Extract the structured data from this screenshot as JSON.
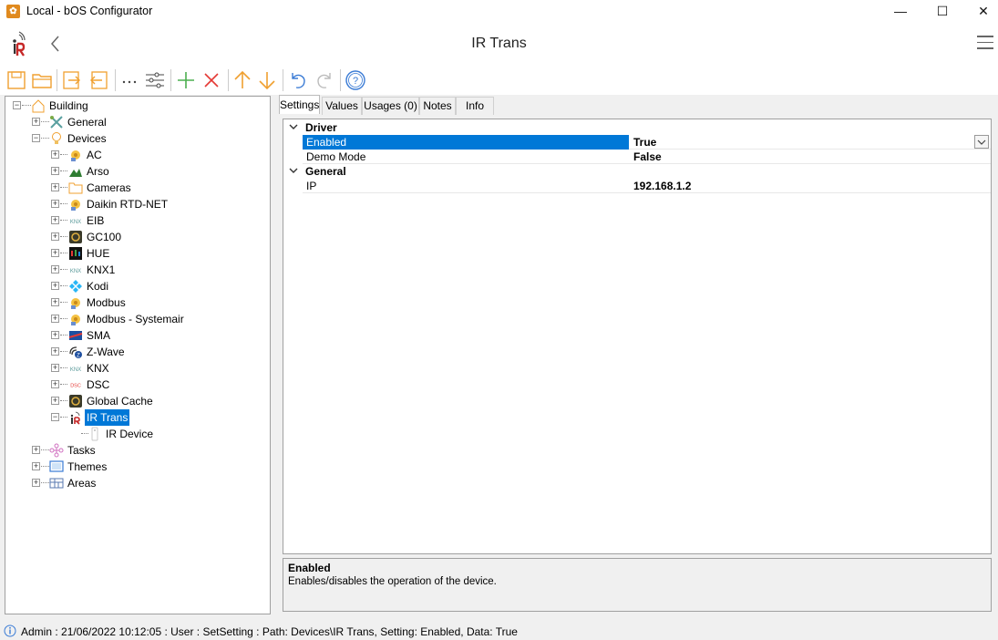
{
  "window": {
    "title": "Local - bOS Configurator",
    "minimize": "—",
    "maximize": "☐",
    "close": "✕"
  },
  "header": {
    "title": "IR Trans"
  },
  "tree": {
    "root": "Building",
    "items": [
      {
        "label": "General",
        "icon": "general-icon"
      },
      {
        "label": "Devices",
        "icon": "bulb-icon"
      },
      {
        "label": "AC",
        "icon": "driver-icon"
      },
      {
        "label": "Arso",
        "icon": "arso-icon"
      },
      {
        "label": "Cameras",
        "icon": "folder-icon"
      },
      {
        "label": "Daikin RTD-NET",
        "icon": "driver-icon"
      },
      {
        "label": "EIB",
        "icon": "knx-icon"
      },
      {
        "label": "GC100",
        "icon": "globalcache-icon"
      },
      {
        "label": "HUE",
        "icon": "hue-icon"
      },
      {
        "label": "KNX1",
        "icon": "knx-icon"
      },
      {
        "label": "Kodi",
        "icon": "kodi-icon"
      },
      {
        "label": "Modbus",
        "icon": "driver-icon"
      },
      {
        "label": "Modbus - Systemair",
        "icon": "driver-icon"
      },
      {
        "label": "SMA",
        "icon": "sma-icon"
      },
      {
        "label": "Z-Wave",
        "icon": "zwave-icon"
      },
      {
        "label": "KNX",
        "icon": "knx-icon"
      },
      {
        "label": "DSC",
        "icon": "dsc-icon"
      },
      {
        "label": "Global Cache",
        "icon": "globalcache-icon"
      },
      {
        "label": "IR Trans",
        "icon": "irtrans-icon"
      },
      {
        "label": "IR Device",
        "icon": "remote-icon"
      },
      {
        "label": "Tasks",
        "icon": "tasks-icon"
      },
      {
        "label": "Themes",
        "icon": "themes-icon"
      },
      {
        "label": "Areas",
        "icon": "areas-icon"
      }
    ]
  },
  "tabs": [
    {
      "label": "Settings"
    },
    {
      "label": "Values"
    },
    {
      "label": "Usages (0)"
    },
    {
      "label": "Notes"
    },
    {
      "label": "Info"
    }
  ],
  "grid": {
    "categories": [
      {
        "name": "Driver",
        "props": [
          {
            "name": "Enabled",
            "value": "True"
          },
          {
            "name": "Demo Mode",
            "value": "False"
          }
        ]
      },
      {
        "name": "General",
        "props": [
          {
            "name": "IP",
            "value": "192.168.1.2"
          }
        ]
      }
    ]
  },
  "description": {
    "title": "Enabled",
    "text": "Enables/disables the operation of the device."
  },
  "status": {
    "text": "Admin : 21/06/2022 10:12:05 : User : SetSetting : Path: Devices\\IR Trans, Setting: Enabled, Data: True"
  },
  "colors": {
    "selection": "#0078d7",
    "toolbar_orange": "#f0a030",
    "toolbar_green": "#4caf50",
    "toolbar_red": "#e53935",
    "toolbar_blue": "#3a7bd5"
  }
}
